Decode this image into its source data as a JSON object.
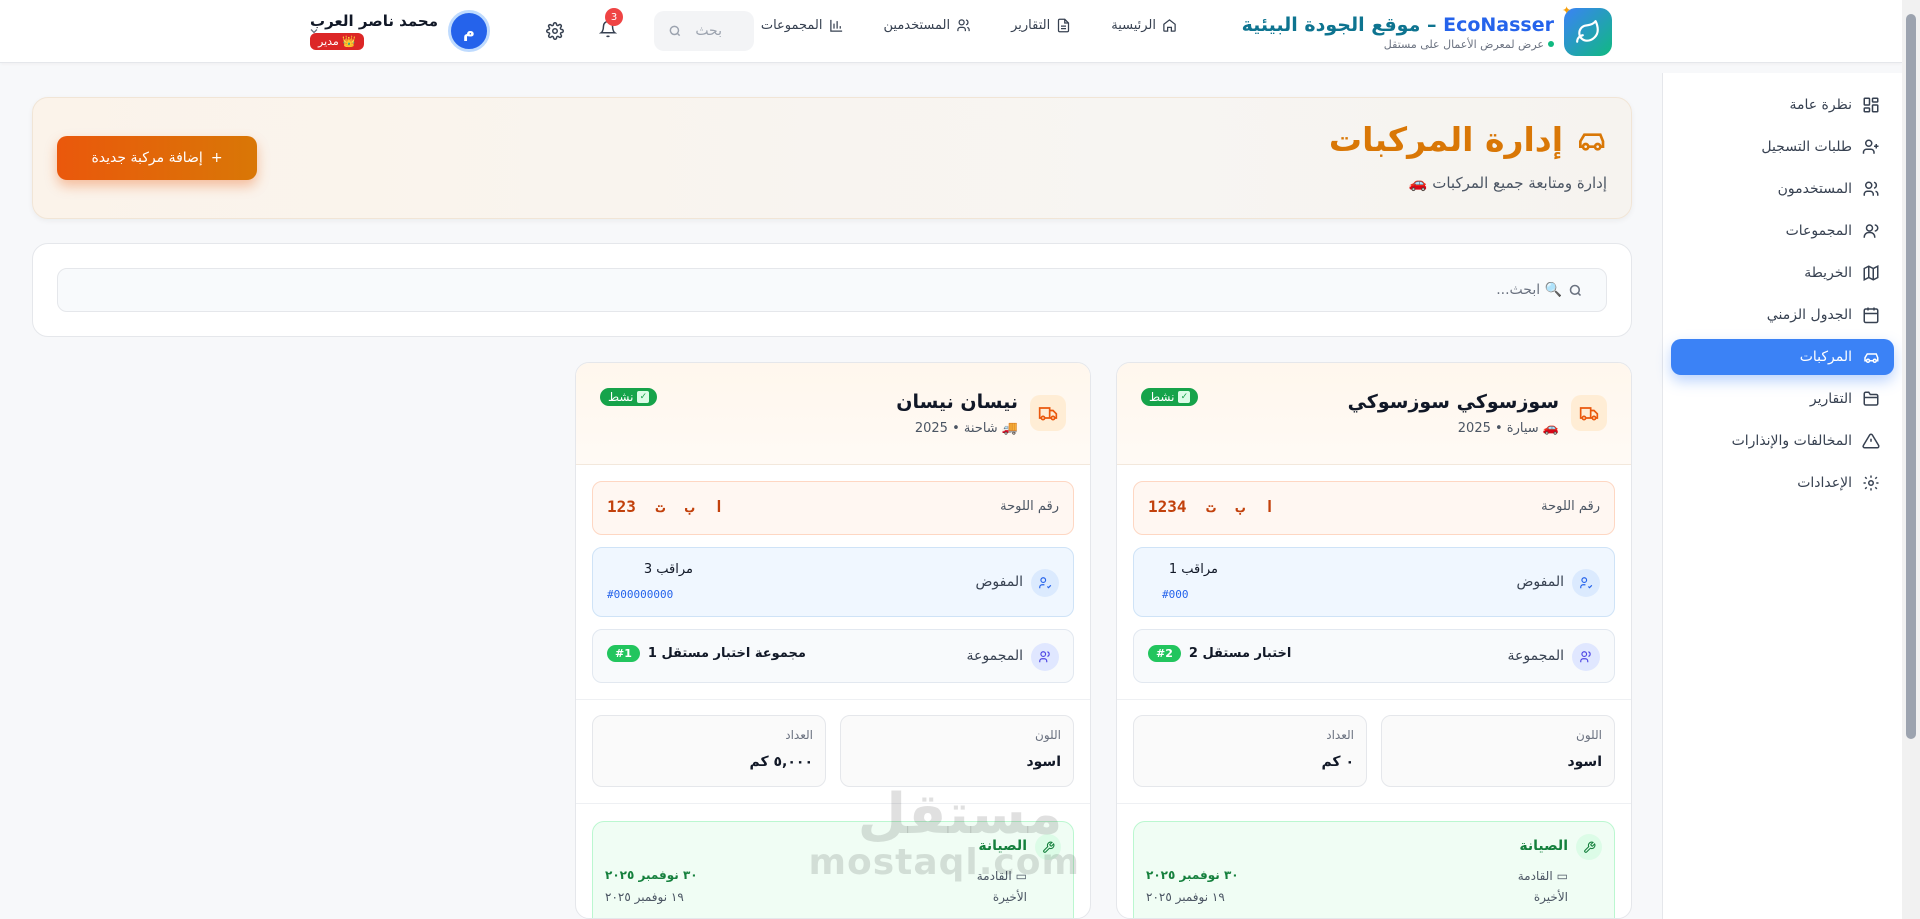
{
  "brand": {
    "title_en": "EcoNasser",
    "title_ar": " – موقع الجودة البيئية",
    "subtitle": "عرض لمعرض الأعمال على مستقل"
  },
  "nav": [
    {
      "label": "الرئيسية",
      "icon": "home-icon"
    },
    {
      "label": "التقارير",
      "icon": "file-icon"
    },
    {
      "label": "المستخدمين",
      "icon": "users-icon"
    },
    {
      "label": "المجموعات",
      "icon": "chart-icon"
    }
  ],
  "topbar": {
    "search_placeholder": "بحث",
    "notifications_count": "3"
  },
  "user": {
    "name": "محمد ناصر العرب",
    "initial": "م",
    "role": "👑 مدير"
  },
  "sidebar": [
    {
      "label": "نظرة عامة",
      "icon": "dashboard-icon",
      "active": false
    },
    {
      "label": "طلبات التسجيل",
      "icon": "user-plus-icon",
      "active": false
    },
    {
      "label": "المستخدمون",
      "icon": "users-icon",
      "active": false
    },
    {
      "label": "المجموعات",
      "icon": "group-icon",
      "active": false
    },
    {
      "label": "الخريطة",
      "icon": "map-icon",
      "active": false
    },
    {
      "label": "الجدول الزمني",
      "icon": "calendar-icon",
      "active": false
    },
    {
      "label": "المركبات",
      "icon": "car-icon",
      "active": true
    },
    {
      "label": "التقارير",
      "icon": "folder-icon",
      "active": false
    },
    {
      "label": "المخالفات والإنذارات",
      "icon": "warning-icon",
      "active": false
    },
    {
      "label": "الإعدادات",
      "icon": "settings-icon",
      "active": false
    }
  ],
  "page": {
    "title": "إدارة المركبات",
    "subtitle": "إدارة ومتابعة جميع المركبات 🚗",
    "add_button": "إضافة مركبة جديدة",
    "search_placeholder": "🔍 ابحث..."
  },
  "vehicles": [
    {
      "name": "سوزسوكي سوزسوكي",
      "meta": "🚗 سيارة • 2025",
      "status": "نشط",
      "plate_label": "رقم اللوحة",
      "plate": "ا ب ت 1234",
      "delegate_label": "المفوض",
      "delegate_name": "مراقب 1",
      "delegate_id": "#000",
      "group_label": "المجموعة",
      "group_name": "اختبار مستقل 2",
      "group_badge": "#2",
      "color_label": "اللون",
      "color_value": "اسود",
      "odometer_label": "العداد",
      "odometer_value": "٠ كم",
      "maint_title": "الصيانة",
      "maint_next_label": "القادمة",
      "maint_next": "٣٠ نوفمبر ٢٠٢٥",
      "maint_last_label": "الأخيرة",
      "maint_last": "١٩ نوفمبر ٢٠٢٥"
    },
    {
      "name": "نيسان نيسان",
      "meta": "🚚 شاحنة • 2025",
      "status": "نشط",
      "plate_label": "رقم اللوحة",
      "plate": "ا ب ت 123",
      "delegate_label": "المفوض",
      "delegate_name": "مراقب 3",
      "delegate_id": "#000000000",
      "group_label": "المجموعة",
      "group_name": "مجموعة اختبار مستقل 1",
      "group_badge": "#1",
      "color_label": "اللون",
      "color_value": "اسود",
      "odometer_label": "العداد",
      "odometer_value": "٥,٠٠٠ كم",
      "maint_title": "الصيانة",
      "maint_next_label": "القادمة",
      "maint_next": "٣٠ نوفمبر ٢٠٢٥",
      "maint_last_label": "الأخيرة",
      "maint_last": "١٩ نوفمبر ٢٠٢٥"
    }
  ],
  "watermark": {
    "ar": "مستقل",
    "en": "mostaql.com"
  },
  "colors": {
    "accent": "#3b82f6",
    "brand_orange": "#d97706",
    "status_green": "#16a34a"
  }
}
